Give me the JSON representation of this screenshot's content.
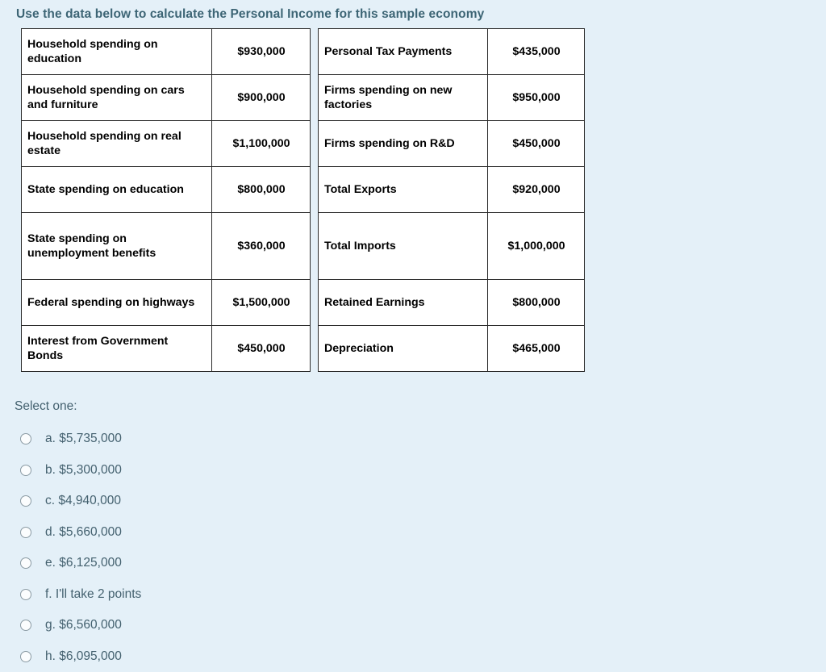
{
  "question": {
    "title": "Use the data below to calculate the Personal Income for this sample economy",
    "select_prompt": "Select one:"
  },
  "tables": {
    "left": {
      "rows": [
        {
          "label": "Household spending on education",
          "value": "$930,000",
          "tall": false
        },
        {
          "label": "Household spending on cars and furniture",
          "value": "$900,000",
          "tall": false
        },
        {
          "label": "Household spending on real estate",
          "value": "$1,100,000",
          "tall": false
        },
        {
          "label": "State spending on education",
          "value": "$800,000",
          "tall": false
        },
        {
          "label": "State spending on unemployment benefits",
          "value": "$360,000",
          "tall": true
        },
        {
          "label": "Federal spending on highways",
          "value": "$1,500,000",
          "tall": false
        },
        {
          "label": "Interest from Government Bonds",
          "value": "$450,000",
          "tall": false
        }
      ]
    },
    "right": {
      "rows": [
        {
          "label": "Personal Tax Payments",
          "value": "$435,000",
          "tall": false
        },
        {
          "label": "Firms spending on new factories",
          "value": "$950,000",
          "tall": false
        },
        {
          "label": "Firms spending on R&D",
          "value": "$450,000",
          "tall": false
        },
        {
          "label": "Total Exports",
          "value": "$920,000",
          "tall": false
        },
        {
          "label": "Total Imports",
          "value": "$1,000,000",
          "tall": true
        },
        {
          "label": "Retained Earnings",
          "value": "$800,000",
          "tall": false
        },
        {
          "label": "Depreciation",
          "value": "$465,000",
          "tall": false
        }
      ]
    }
  },
  "options": [
    {
      "text": "a. $5,735,000"
    },
    {
      "text": "b. $5,300,000"
    },
    {
      "text": "c. $4,940,000"
    },
    {
      "text": "d. $5,660,000"
    },
    {
      "text": "e. $6,125,000"
    },
    {
      "text": "f. I'll take 2 points"
    },
    {
      "text": "g. $6,560,000"
    },
    {
      "text": "h. $6,095,000"
    }
  ],
  "colors": {
    "page_background": "#e4f0f8",
    "title_text": "#3d6575",
    "option_text": "#44616f",
    "table_border": "#2b2b2b",
    "table_background": "#ffffff"
  }
}
